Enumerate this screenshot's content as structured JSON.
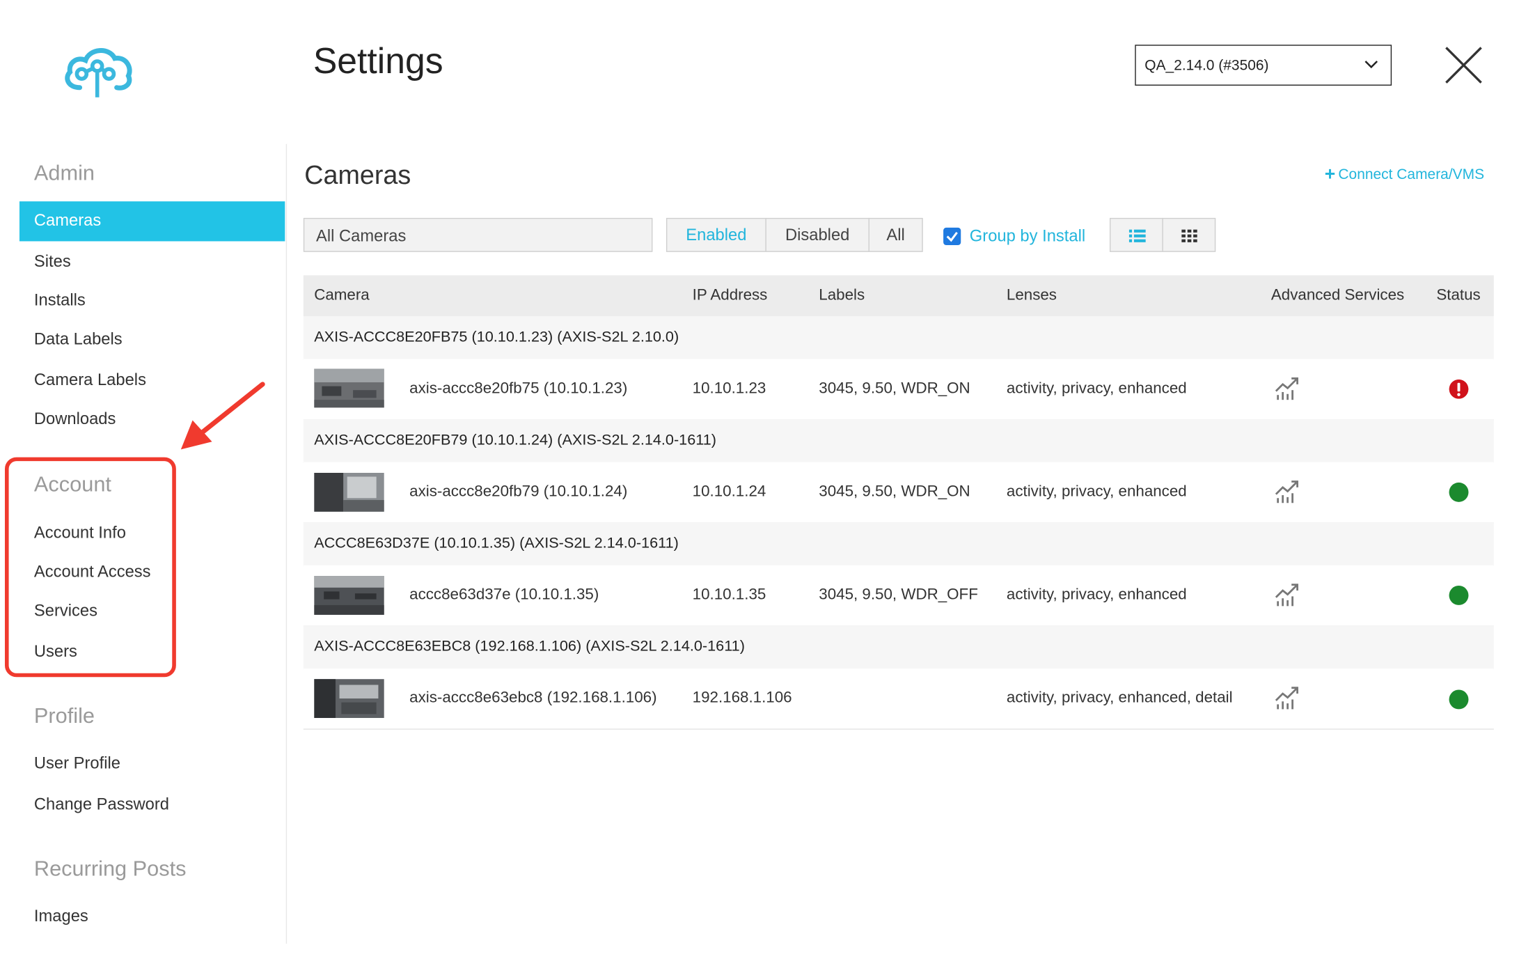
{
  "header": {
    "title": "Settings",
    "version_select": "QA_2.14.0 (#3506)"
  },
  "sidebar": {
    "admin": {
      "heading": "Admin",
      "items": [
        "Cameras",
        "Sites",
        "Installs",
        "Data Labels",
        "Camera Labels",
        "Downloads"
      ],
      "active": "Cameras"
    },
    "account": {
      "heading": "Account",
      "items": [
        "Account Info",
        "Account Access",
        "Services",
        "Users"
      ]
    },
    "profile": {
      "heading": "Profile",
      "items": [
        "User Profile",
        "Change Password"
      ]
    },
    "recurring": {
      "heading": "Recurring Posts",
      "items": [
        "Images"
      ]
    }
  },
  "main": {
    "title": "Cameras",
    "connect_link": "Connect Camera/VMS",
    "filter_value": "All Cameras",
    "status_filters": [
      "Enabled",
      "Disabled",
      "All"
    ],
    "status_filter_selected": "Enabled",
    "group_by_label": "Group by Install",
    "group_by_checked": true,
    "columns": [
      "Camera",
      "IP Address",
      "Labels",
      "Lenses",
      "Advanced Services",
      "Status"
    ],
    "groups": [
      {
        "title": "AXIS-ACCC8E20FB75 (10.10.1.23) (AXIS-S2L 2.10.0)",
        "camera": "axis-accc8e20fb75 (10.10.1.23)",
        "ip": "10.10.1.23",
        "labels": "3045, 9.50, WDR_ON",
        "lenses": "activity, privacy, enhanced",
        "status": "error"
      },
      {
        "title": "AXIS-ACCC8E20FB79 (10.10.1.24) (AXIS-S2L 2.14.0-1611)",
        "camera": "axis-accc8e20fb79 (10.10.1.24)",
        "ip": "10.10.1.24",
        "labels": "3045, 9.50, WDR_ON",
        "lenses": "activity, privacy, enhanced",
        "status": "ok"
      },
      {
        "title": "ACCC8E63D37E (10.10.1.35) (AXIS-S2L 2.14.0-1611)",
        "camera": "accc8e63d37e (10.10.1.35)",
        "ip": "10.10.1.35",
        "labels": "3045, 9.50, WDR_OFF",
        "lenses": "activity, privacy, enhanced",
        "status": "ok"
      },
      {
        "title": "AXIS-ACCC8E63EBC8 (192.168.1.106) (AXIS-S2L 2.14.0-1611)",
        "camera": "axis-accc8e63ebc8 (192.168.1.106)",
        "ip": "192.168.1.106",
        "labels": "",
        "lenses": "activity, privacy, enhanced, detail",
        "status": "ok"
      }
    ]
  },
  "icons": {
    "logo": "cloud-network-logo",
    "close": "close-icon",
    "service": "trend-chart-icon",
    "list_view": "list-view-icon",
    "grid_view": "grid-view-icon"
  },
  "colors": {
    "accent": "#22c3e6",
    "link": "#22b5dc",
    "status_ok": "#1b8a2e",
    "status_error": "#d0121b",
    "annotation": "#f03a2e"
  }
}
